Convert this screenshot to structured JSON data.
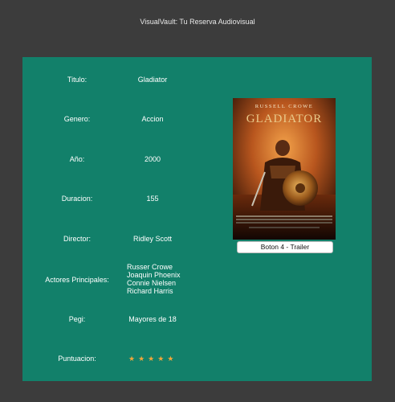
{
  "window": {
    "title": "VisualVault: Tu Reserva Audiovisual"
  },
  "movie": {
    "titulo_label": "Titulo:",
    "titulo": "Gladiator",
    "genero_label": "Genero:",
    "genero": "Accion",
    "anio_label": "Año:",
    "anio": "2000",
    "duracion_label": "Duracion:",
    "duracion": "155",
    "director_label": "Director:",
    "director": "Ridley Scott",
    "actores_label": "Actores Principales:",
    "actores": [
      "Russer Crowe",
      "Joaquin Phoenix",
      "Connie Nielsen",
      "Richard Harris"
    ],
    "pegi_label": "Pegi:",
    "pegi": "Mayores de 18",
    "puntuacion_label": "Puntuacion:",
    "puntuacion_stars": 5,
    "star_glyph": "★"
  },
  "poster": {
    "actor_text": "RUSSELL CROWE",
    "title_text": "GLADIATOR"
  },
  "trailer_button": {
    "label": "Boton 4 - Trailer"
  },
  "colors": {
    "background": "#3c3c3c",
    "panel": "#12806a",
    "star": "#f0a63a"
  }
}
